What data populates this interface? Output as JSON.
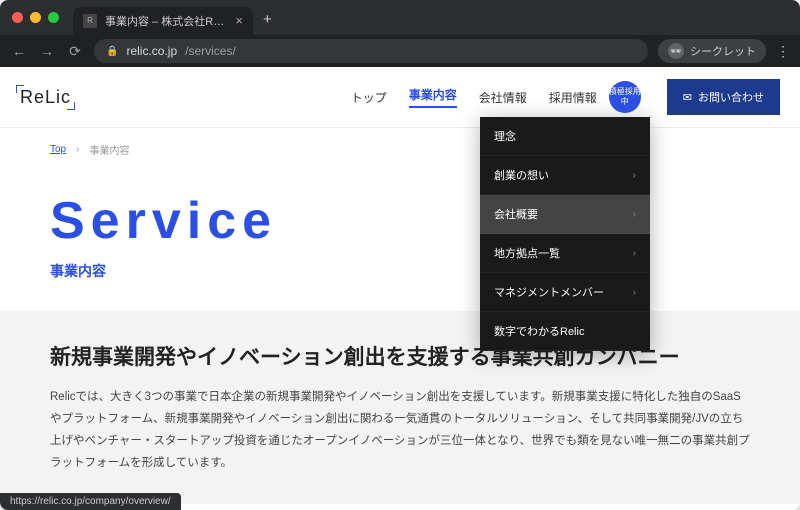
{
  "browser": {
    "tab_title": "事業内容 – 株式会社Relic(レリッ…",
    "url_host": "relic.co.jp",
    "url_path": "/services/",
    "incognito_label": "シークレット",
    "status_url": "https://relic.co.jp/company/overview/"
  },
  "header": {
    "logo": "ReLic",
    "nav": [
      {
        "label": "トップ"
      },
      {
        "label": "事業内容"
      },
      {
        "label": "会社情報"
      },
      {
        "label": "採用情報"
      }
    ],
    "badge": "積極採用中",
    "contact_label": "お問い合わせ"
  },
  "dropdown": {
    "items": [
      {
        "label": "理念"
      },
      {
        "label": "創業の想い",
        "arrow": true
      },
      {
        "label": "会社概要",
        "arrow": true,
        "hover": true
      },
      {
        "label": "地方拠点一覧",
        "arrow": true
      },
      {
        "label": "マネジメントメンバー",
        "arrow": true
      },
      {
        "label": "数字でわかるRelic"
      }
    ]
  },
  "breadcrumb": {
    "top": "Top",
    "current": "事業内容"
  },
  "hero": {
    "title": "Service",
    "subtitle": "事業内容"
  },
  "section": {
    "title": "新規事業開発やイノベーション創出を支援する事業共創カンパニー",
    "body": "Relicでは、大きく3つの事業で日本企業の新規事業開発やイノベーション創出を支援しています。新規事業支援に特化した独自のSaaSやプラットフォーム、新規事業開発やイノベーション創出に関わる一気通貫のトータルソリューション、そして共同事業開発/JVの立ち上げやベンチャー・スタートアップ投資を通じたオープンイノベーションが三位一体となり、世界でも類を見ない唯一無二の事業共創プラットフォームを形成しています。"
  }
}
